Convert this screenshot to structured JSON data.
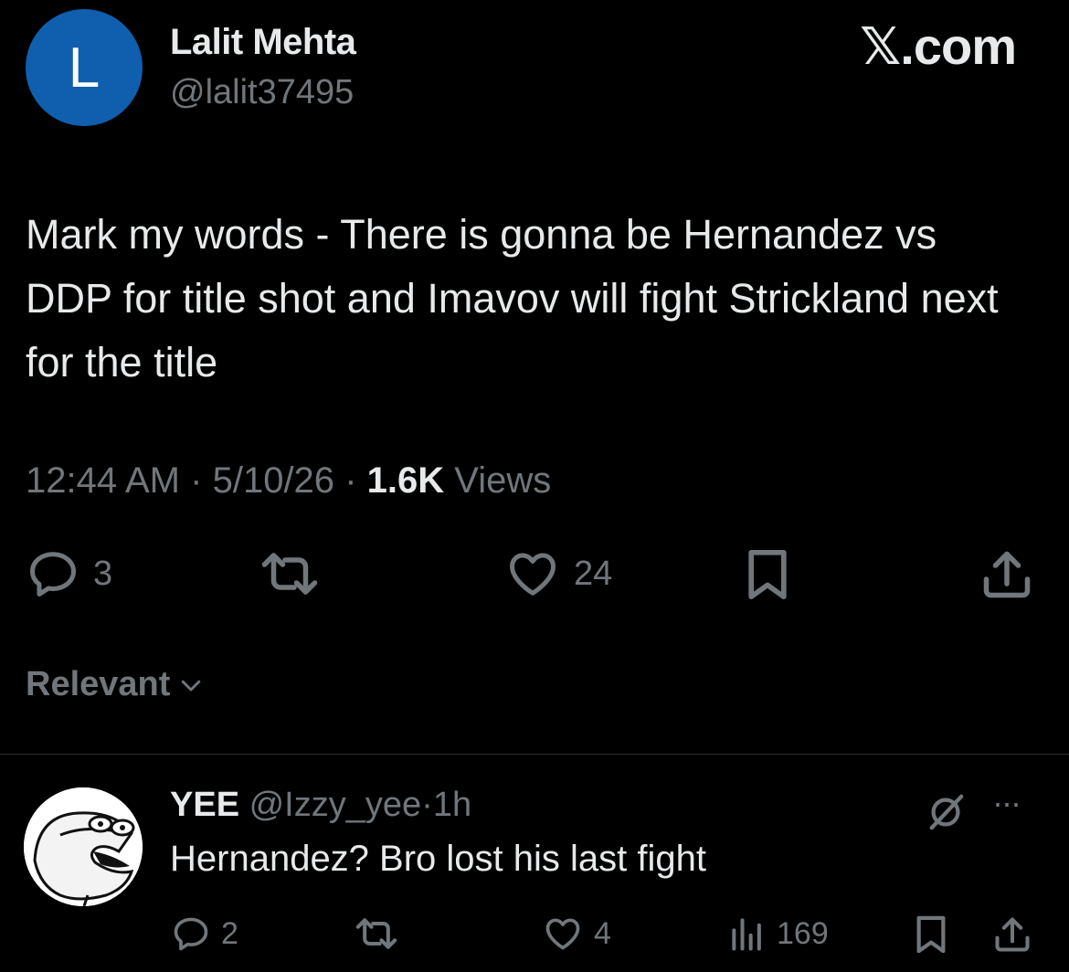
{
  "tweet": {
    "avatar_letter": "L",
    "author_name": "Lalit Mehta",
    "author_handle": "@lalit37495",
    "brand": "𝕏.com",
    "text": "Mark my words - There is gonna be Hernandez vs DDP for title shot and Imavov will fight Strickland next for the title",
    "time": "12:44 AM",
    "date": "5/10/26",
    "views_count": "1.6K",
    "views_label": "Views",
    "sep": "·",
    "replies": "3",
    "likes": "24"
  },
  "sort": {
    "label": "Relevant"
  },
  "reply": {
    "name": "YEE",
    "handle": "@Izzy_yee",
    "sep": "·",
    "age": "1h",
    "text": "Hernandez? Bro lost his last fight",
    "replies": "2",
    "likes": "4",
    "views": "169",
    "more": "···"
  },
  "colors": {
    "background": "#000000",
    "text_primary": "#e7e9ea",
    "text_secondary": "#71767b",
    "avatar_blue": "#0f5fae"
  }
}
